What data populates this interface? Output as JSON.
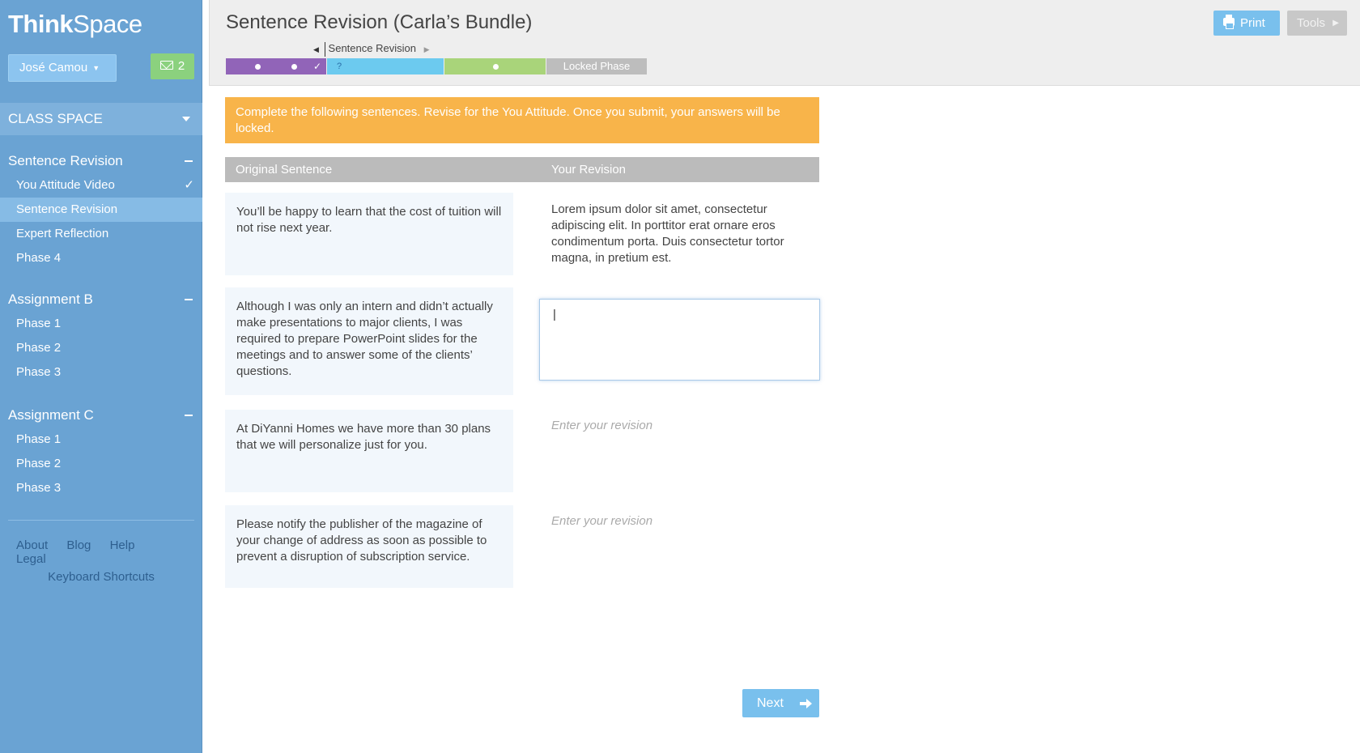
{
  "app": {
    "logo_bold": "Think",
    "logo_light": "Space"
  },
  "user": {
    "name": "José Camou",
    "message_count": "2"
  },
  "sidebar": {
    "class_space_label": "CLASS SPACE",
    "groups": [
      {
        "title": "Sentence Revision",
        "items": [
          {
            "label": "You Attitude Video",
            "completed": true,
            "check": "✓"
          },
          {
            "label": "Sentence Revision",
            "active": true
          },
          {
            "label": "Expert Reflection"
          },
          {
            "label": "Phase 4"
          }
        ]
      },
      {
        "title": "Assignment B",
        "items": [
          {
            "label": "Phase 1"
          },
          {
            "label": "Phase 2"
          },
          {
            "label": "Phase 3"
          }
        ]
      },
      {
        "title": "Assignment C",
        "items": [
          {
            "label": "Phase 1"
          },
          {
            "label": "Phase 2"
          },
          {
            "label": "Phase 3"
          }
        ]
      }
    ],
    "footer_links": [
      "About",
      "Blog",
      "Help",
      "Legal"
    ],
    "keyboard_shortcuts": "Keyboard Shortcuts"
  },
  "header": {
    "title": "Sentence Revision (Carla’s Bundle)",
    "print_label": "Print",
    "tools_label": "Tools",
    "current_phase_label": "Sentence Revision",
    "phase_bar": {
      "question_mark": "?",
      "check_mark": "✓",
      "locked_label": "Locked Phase",
      "colors": {
        "phase1": "#9164b8",
        "phase2": "#6ccaef",
        "phase3": "#a9d47a",
        "locked": "#bdbdbd"
      }
    }
  },
  "content": {
    "instructions": "Complete the following sentences. Revise for the You Attitude. Once you submit, your answers will be locked.",
    "table_headers": {
      "original": "Original Sentence",
      "revision": "Your Revision"
    },
    "rows": [
      {
        "original": "You’ll be happy to learn that the cost of tuition will not rise next year.",
        "revision": "Lorem ipsum dolor sit amet, consectetur adipiscing elit. In porttitor erat ornare eros condimentum porta. Duis consectetur tortor magna, in pretium est."
      },
      {
        "original": "Although I was only an intern and didn’t actually make presentations to major clients, I was required to prepare PowerPoint slides for the meetings and to answer some of the clients’ questions.",
        "revision": "|"
      },
      {
        "original": "At DiYanni Homes we have more than 30 plans that we will personalize just for you.",
        "placeholder": "Enter your revision"
      },
      {
        "original": "Please notify the publisher of the magazine of your change of address as soon as possible to prevent a disruption of subscription service.",
        "placeholder": "Enter your revision"
      }
    ],
    "next_label": "Next"
  },
  "colors": {
    "sidebar": "#6aa3d3",
    "accent_blue": "#79c0ed",
    "banner": "#f8b44a",
    "message_green": "#8bd17e"
  }
}
